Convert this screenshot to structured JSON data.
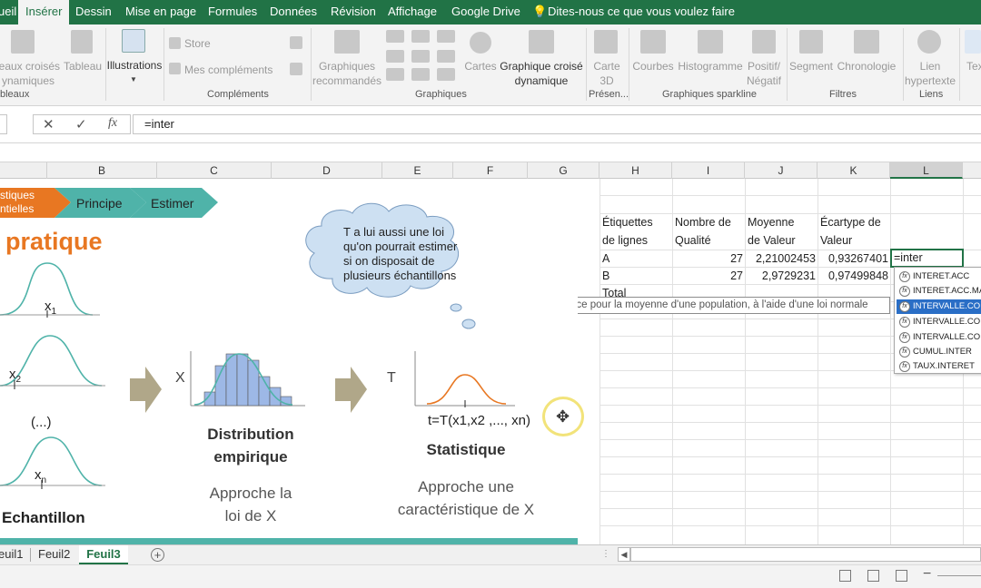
{
  "ribbon_tabs": [
    "ueil",
    "Insérer",
    "Dessin",
    "Mise en page",
    "Formules",
    "Données",
    "Révision",
    "Affichage",
    "Google Drive",
    "Dites-nous ce que vous voulez faire"
  ],
  "ribbon": {
    "tableaux_croises": [
      "leaux croisés",
      "ynamiques"
    ],
    "tableau": "Tableau",
    "tableaux_group": "bleaux",
    "illustrations": "Illustrations",
    "store": "Store",
    "mes_complements": "Mes compléments",
    "complements_group": "Compléments",
    "graph_recommandes": [
      "Graphiques",
      "recommandés"
    ],
    "cartes": "Cartes",
    "graph_croise": [
      "Graphique croisé",
      "dynamique"
    ],
    "graphiques_group": "Graphiques",
    "carte3d": [
      "Carte",
      "3D"
    ],
    "presentations_group": "Présen...",
    "courbes": "Courbes",
    "histogramme": "Histogramme",
    "positif": [
      "Positif/",
      "Négatif"
    ],
    "sparkline_group": "Graphiques sparkline",
    "segment": "Segment",
    "chronologie": "Chronologie",
    "filtres_group": "Filtres",
    "lien": [
      "Lien",
      "hypertexte"
    ],
    "liens_group": "Liens",
    "texte": "Tex"
  },
  "formula_bar": {
    "cancel": "✕",
    "enter": "✓",
    "fx": "fx",
    "value": "=inter"
  },
  "columns": [
    "B",
    "C",
    "D",
    "E",
    "F",
    "G",
    "H",
    "I",
    "J",
    "K",
    "L"
  ],
  "slide": {
    "nav": [
      "stiques",
      "ntielles",
      "Principe",
      "Estimer"
    ],
    "title": "pratique",
    "x1": "x",
    "x1_sub": "1",
    "x2": "x",
    "x2_sub": "2",
    "xn": "x",
    "xn_sub": "n",
    "dots": "(...)",
    "echantillon": "Echantillon",
    "hist_axis": "X",
    "distribution": [
      "Distribution",
      "empirique"
    ],
    "approche_loi": [
      "Approche la",
      "loi de X"
    ],
    "stat_axis": "T",
    "formula": "t=T(x1,x2 ,..., xn)",
    "statistique": "Statistique",
    "approche_carac": [
      "Approche une",
      "caractéristique de X"
    ],
    "cloud_text": [
      "T a lui aussi une loi",
      "qu'on pourrait estimer",
      "si on disposait de",
      "plusieurs échantillons"
    ]
  },
  "pivot": {
    "headers": [
      [
        "Étiquettes",
        "de lignes"
      ],
      [
        "Nombre de",
        "Qualité"
      ],
      [
        "Moyenne",
        "de Valeur"
      ],
      [
        "Écartype de",
        "Valeur"
      ]
    ],
    "rows": [
      {
        "label": "A",
        "count": "27",
        "mean": "2,21002453",
        "sd": "0,93267401",
        "extra": "=inter"
      },
      {
        "label": "B",
        "count": "27",
        "mean": "2,9729231",
        "sd": "0,97499848",
        "extra": ""
      },
      {
        "label": "Total",
        "count": "",
        "mean": "",
        "sd": "",
        "extra": ""
      }
    ]
  },
  "autocomplete": [
    "INTERET.ACC",
    "INTERET.ACC.MA",
    "INTERVALLE.CO",
    "INTERVALLE.CO",
    "INTERVALLE.CO",
    "CUMUL.INTER",
    "TAUX.INTERET"
  ],
  "tooltip": "Renvoie l'intervalle de confiance pour la moyenne d'une population, à l'aide d'une loi normale",
  "sheets": [
    "euil1",
    "Feuil2",
    "Feuil3"
  ],
  "colors": {
    "excel_green": "#217346",
    "slide_orange": "#e87722",
    "slide_teal": "#4fb3a9",
    "hist_blue": "#9db8e6"
  }
}
